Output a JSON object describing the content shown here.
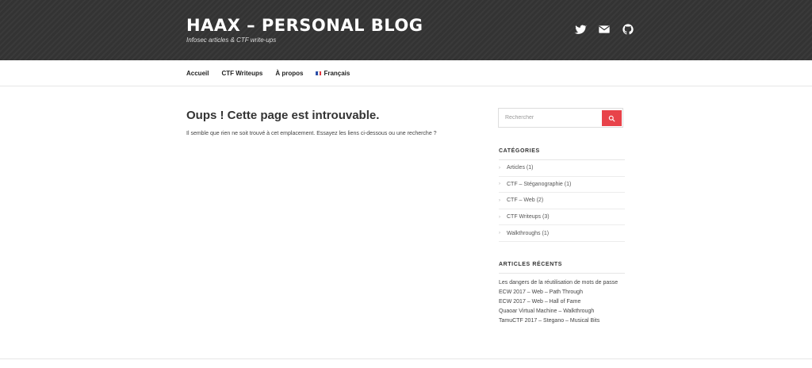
{
  "site": {
    "title": "HAAX – PERSONAL BLOG",
    "description": "Infosec articles & CTF write-ups"
  },
  "social": [
    {
      "icon": "twitter-icon"
    },
    {
      "icon": "envelope-icon"
    },
    {
      "icon": "github-icon"
    }
  ],
  "nav": {
    "items": [
      {
        "label": "Accueil"
      },
      {
        "label": "CTF Writeups"
      },
      {
        "label": "À propos"
      },
      {
        "label": "Français",
        "icon": "france-flag-icon"
      }
    ]
  },
  "main": {
    "title": "Oups ! Cette page est introuvable.",
    "text": "Il semble que rien ne soit trouvé à cet emplacement. Essayez les liens ci-dessous ou une recherche ?"
  },
  "search": {
    "placeholder": "Rechercher",
    "button_icon": "search-icon"
  },
  "categories": {
    "title": "CATÉGORIES",
    "items": [
      {
        "label": "Articles (1)"
      },
      {
        "label": "CTF – Stéganographie (1)"
      },
      {
        "label": "CTF – Web (2)"
      },
      {
        "label": "CTF Writeups (3)"
      },
      {
        "label": "Walkthroughs (1)"
      }
    ]
  },
  "recent": {
    "title": "ARTICLES RÉCENTS",
    "items": [
      {
        "label": "Les dangers de la réutilisation de mots de passe"
      },
      {
        "label": "ECW 2017 – Web – Path Through"
      },
      {
        "label": "ECW 2017 – Web – Hall of Fame"
      },
      {
        "label": "Quaoar Virtual Machine – Walkthrough"
      },
      {
        "label": "TamuCTF 2017 – Stegano – Musical Bits"
      }
    ]
  },
  "colors": {
    "header_bg": "#333333",
    "accent": "#e8434a"
  }
}
